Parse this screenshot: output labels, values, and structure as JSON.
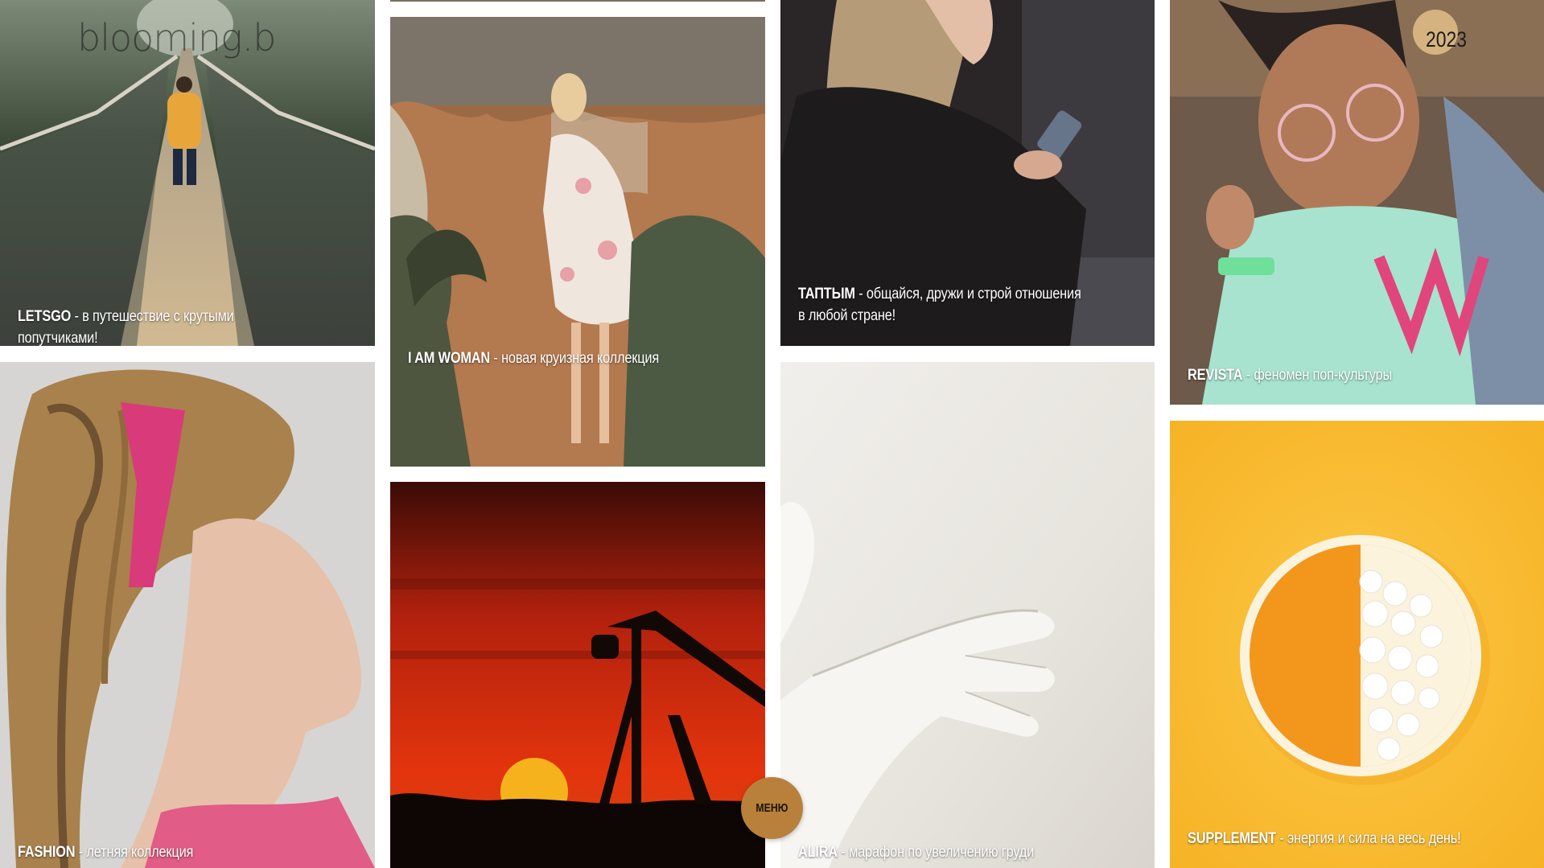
{
  "brand": {
    "logo_text": "blooming.b",
    "year": "2023"
  },
  "menu": {
    "label": "МЕНЮ"
  },
  "tiles": {
    "letsgo": {
      "name": "LETSGO",
      "desc": " - в путешествие с крутыми попутчиками!"
    },
    "fashion": {
      "name": "FASHION",
      "desc": " - летняя коллекция"
    },
    "iamwoman": {
      "name": "I AM WOMAN",
      "desc": " - новая круизная коллекция"
    },
    "taptym": {
      "name": "ТАПТЫМ",
      "desc": " - общайся, дружи и строй отношения в любой стране!"
    },
    "alira": {
      "name": "ALIRA",
      "desc": " - марафон по увеличению груди"
    },
    "revista": {
      "name": "REVISTA",
      "desc": " - феномен поп-культуры"
    },
    "supplement": {
      "name": "SUPPLEMENT",
      "desc": " - энергия и сила на весь день!"
    }
  },
  "colors": {
    "menu_button": "#b8803a",
    "supplement_bg": "#f8bd33",
    "sunset": "#e3340d",
    "sky_top": "#3a0b06"
  },
  "images": {
    "letsgo": "photo-suspension-bridge",
    "fashion": "photo-woman-dreadlocks",
    "iamwoman": "photo-woman-floral-dress",
    "oil": "photo-oil-pump-sunset",
    "taptym": "photo-woman-phone",
    "alira": "photo-plaster-sculpture",
    "revista": "photo-woman-glasses",
    "supplement": "photo-orange-pills"
  }
}
